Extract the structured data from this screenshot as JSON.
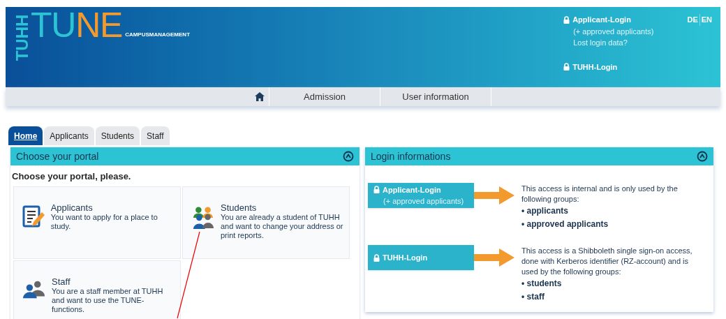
{
  "header": {
    "logo": {
      "side": "TUHH",
      "first": "TU",
      "second": "NE",
      "subtitle": "CAMPUSMANAGEMENT"
    },
    "logins": [
      {
        "label": "Applicant-Login",
        "lines": [
          "(+ approved applicants)",
          "Lost login data?"
        ]
      },
      {
        "label": "TUHH-Login"
      }
    ],
    "languages": [
      "DE",
      "EN"
    ]
  },
  "nav": {
    "items": [
      "Admission",
      "User information"
    ]
  },
  "tabs": [
    {
      "label": "Home",
      "selected": true
    },
    {
      "label": "Applicants",
      "selected": false
    },
    {
      "label": "Students",
      "selected": false
    },
    {
      "label": "Staff",
      "selected": false
    }
  ],
  "portal_panel": {
    "title": "Choose your portal",
    "expanded": true,
    "intro": "Choose your portal, please.",
    "cards": [
      {
        "kind": "applicant",
        "title": "Applicants",
        "text": "You want to apply for a place to study."
      },
      {
        "kind": "students",
        "title": "Students",
        "text": "You are already a student of TUHH and want to change your address or print reports."
      },
      {
        "kind": "staff",
        "title": "Staff",
        "text": "You are a staff member at TUHH and want to use the TUNE-functions."
      }
    ]
  },
  "login_panel": {
    "title": "Login informations",
    "expanded": true,
    "entries": [
      {
        "label": "Applicant-Login",
        "sub": "(+ approved applicants)",
        "text": "This access is internal and is only used by the following groups:",
        "groups": [
          "• applicants",
          "• approved applicants"
        ]
      },
      {
        "label": "TUHH-Login",
        "text": "This access is a Shibboleth single sign-on access, done with Kerberos identifier (RZ-account) and is used by the following groups:",
        "groups": [
          "• students",
          "• staff"
        ]
      }
    ]
  }
}
